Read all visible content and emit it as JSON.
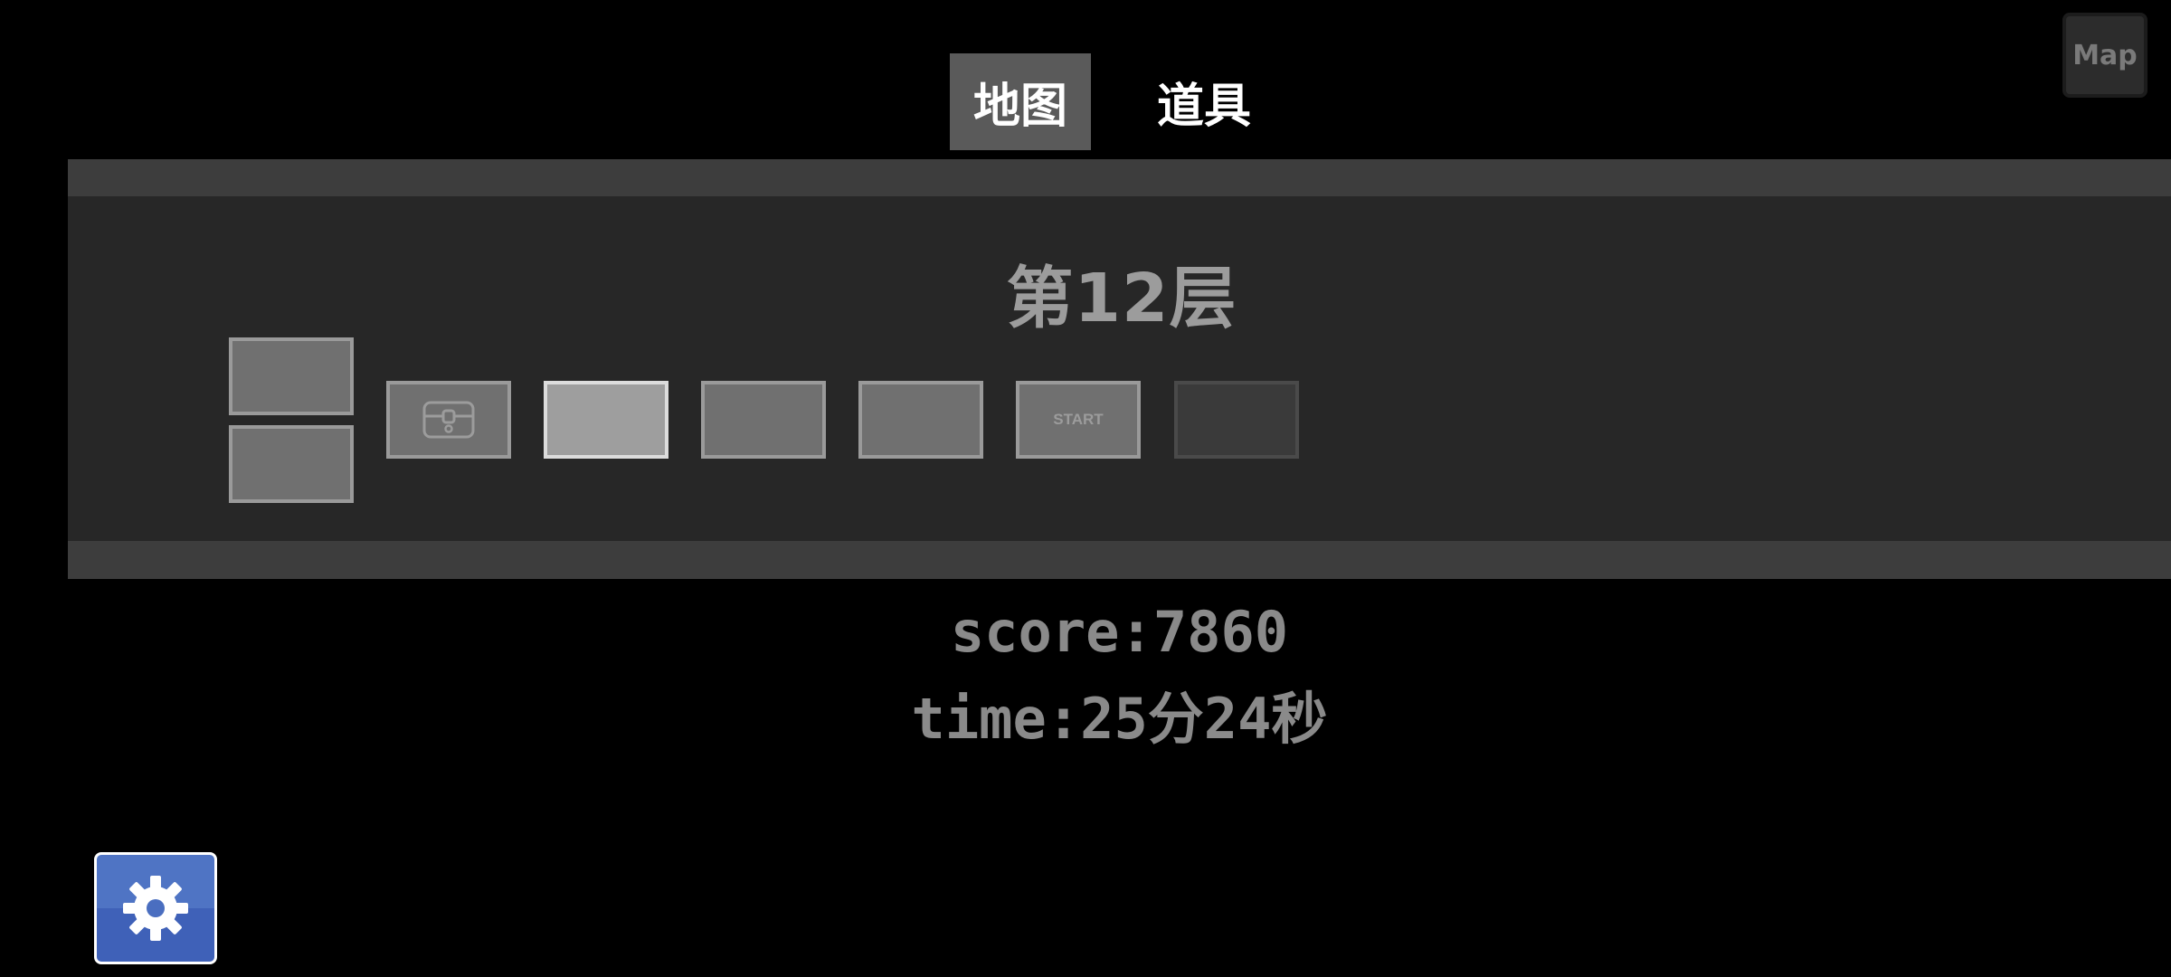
{
  "tabs": [
    {
      "label": "地图",
      "active": true
    },
    {
      "label": "道具",
      "active": false
    }
  ],
  "map_button": {
    "label": "Map"
  },
  "map_panel": {
    "floor_title": "第12层",
    "rooms": [
      {
        "type": "empty"
      },
      {
        "type": "empty"
      },
      {
        "type": "treasure",
        "icon": "treasure-chest-icon"
      },
      {
        "type": "current"
      },
      {
        "type": "empty"
      },
      {
        "type": "empty"
      },
      {
        "type": "start",
        "label": "START"
      },
      {
        "type": "unexplored"
      }
    ]
  },
  "stats": {
    "score": "score:7860",
    "time": "time:25分24秒"
  },
  "settings": {
    "icon": "gear-icon"
  },
  "colors": {
    "background": "#000000",
    "tab_active": "#5a5a5a",
    "panel_strip": "#3d3d3d",
    "panel_body": "#272727",
    "settings_button": "#4f74c4"
  }
}
